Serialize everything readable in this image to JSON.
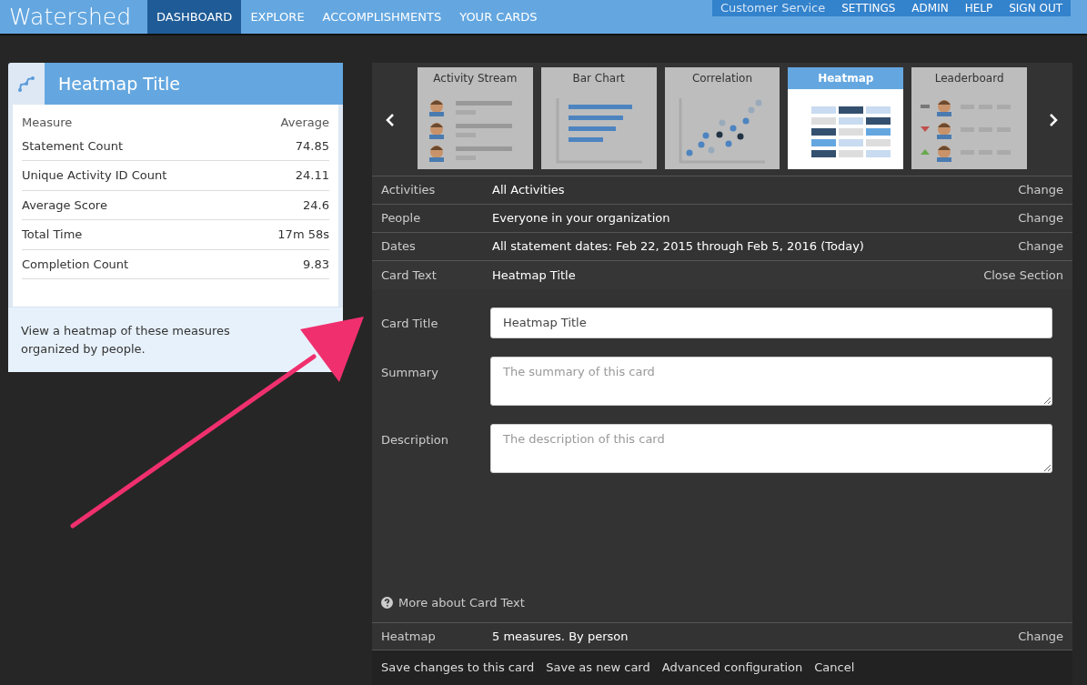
{
  "navbar": {
    "brand": "Watershed",
    "items": [
      {
        "label": "DASHBOARD",
        "selected": true
      },
      {
        "label": "EXPLORE",
        "selected": false
      },
      {
        "label": "ACCOMPLISHMENTS",
        "selected": false
      },
      {
        "label": "YOUR CARDS",
        "selected": false
      }
    ],
    "account": "Customer Service",
    "links": [
      "SETTINGS",
      "ADMIN",
      "HELP",
      "SIGN OUT"
    ]
  },
  "preview_card": {
    "title": "Heatmap Title",
    "columns": [
      "Measure",
      "Average"
    ],
    "rows": [
      [
        "Statement Count",
        "74.85"
      ],
      [
        "Unique Activity ID Count",
        "24.11"
      ],
      [
        "Average Score",
        "24.6"
      ],
      [
        "Total Time",
        "17m 58s"
      ],
      [
        "Completion Count",
        "9.83"
      ]
    ],
    "summary": "View a heatmap of these measures organized by people."
  },
  "card_types": [
    {
      "label": "Activity Stream",
      "kind": "stream",
      "selected": false
    },
    {
      "label": "Bar Chart",
      "kind": "bar",
      "selected": false
    },
    {
      "label": "Correlation",
      "kind": "scatter",
      "selected": false
    },
    {
      "label": "Heatmap",
      "kind": "heatmap",
      "selected": true
    },
    {
      "label": "Leaderboard",
      "kind": "leaderboard",
      "selected": false
    }
  ],
  "settings": [
    {
      "label": "Activities",
      "value": "All Activities",
      "action": "Change"
    },
    {
      "label": "People",
      "value": "Everyone in your organization",
      "action": "Change"
    },
    {
      "label": "Dates",
      "value": "All statement dates: Feb 22, 2015 through Feb 5, 2016 (Today)",
      "action": "Change"
    },
    {
      "label": "Card Text",
      "value": "Heatmap Title",
      "action": "Close Section",
      "expanded": true
    }
  ],
  "card_text_form": {
    "fields": [
      {
        "label": "Card Title",
        "value": "Heatmap Title",
        "kind": "input"
      },
      {
        "label": "Summary",
        "placeholder": "The summary of this card",
        "kind": "textarea"
      },
      {
        "label": "Description",
        "placeholder": "The description of this card",
        "kind": "textarea"
      }
    ],
    "help_link": "More about Card Text"
  },
  "heatmap_row": {
    "label": "Heatmap",
    "value": "5 measures. By person",
    "action": "Change"
  },
  "footer_actions": [
    "Save changes to this card",
    "Save as new card",
    "Advanced configuration",
    "Cancel"
  ]
}
